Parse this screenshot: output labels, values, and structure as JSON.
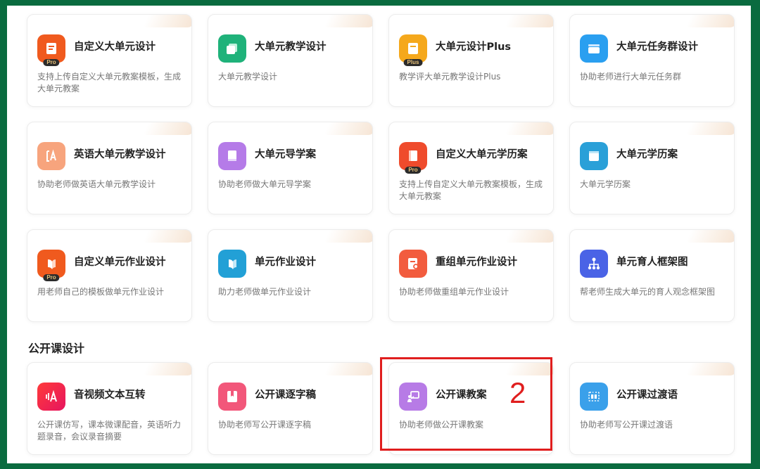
{
  "rows": [
    [
      {
        "title": "自定义大单元设计",
        "desc": "支持上传自定义大单元教案模板，生成大单元教案",
        "icon": "document-pro-icon",
        "color": "#f05a1e",
        "pro": "Pro"
      },
      {
        "title": "大单元教学设计",
        "desc": "大单元教学设计",
        "icon": "layers-icon",
        "color": "#1fb27a",
        "pro": ""
      },
      {
        "title": "大单元设计Plus",
        "desc": "教学评大单元教学设计Plus",
        "icon": "document-plus-icon",
        "color": "#f5a81c",
        "pro": "Plus"
      },
      {
        "title": "大单元任务群设计",
        "desc": "协助老师进行大单元任务群",
        "icon": "folder-icon",
        "color": "#2a9ff0",
        "pro": ""
      }
    ],
    [
      {
        "title": "英语大单元教学设计",
        "desc": "协助老师做英语大单元教学设计",
        "icon": "letter-a-icon",
        "color": "#f7a47d",
        "pro": ""
      },
      {
        "title": "大单元导学案",
        "desc": "协助老师做大单元导学案",
        "icon": "book-icon",
        "color": "#b57be8",
        "pro": ""
      },
      {
        "title": "自定义大单元学历案",
        "desc": "支持上传自定义大单元教案模板，生成大单元教案",
        "icon": "notebook-pro-icon",
        "color": "#ef4b2c",
        "pro": "Pro"
      },
      {
        "title": "大单元学历案",
        "desc": "大单元学历案",
        "icon": "window-icon",
        "color": "#2aa0d8",
        "pro": ""
      }
    ],
    [
      {
        "title": "自定义单元作业设计",
        "desc": "用老师自己的模板做单元作业设计",
        "icon": "pages-pro-icon",
        "color": "#f05a1e",
        "pro": "Pro"
      },
      {
        "title": "单元作业设计",
        "desc": "助力老师做单元作业设计",
        "icon": "pages-icon",
        "color": "#22a0d6",
        "pro": ""
      },
      {
        "title": "重组单元作业设计",
        "desc": "协助老师做重组单元作业设计",
        "icon": "doc-search-icon",
        "color": "#f25c3e",
        "pro": ""
      },
      {
        "title": "单元育人框架图",
        "desc": "帮老师生成大单元的育人观念框架图",
        "icon": "hierarchy-icon",
        "color": "#4a63e6",
        "pro": ""
      }
    ]
  ],
  "section": {
    "title": "公开课设计"
  },
  "public_cards": [
    {
      "title": "音视频文本互转",
      "desc": "公开课仿写，课本微课配音，英语听力题录音，会议录音摘要",
      "icon": "audio-text-icon",
      "color": "#ef2d3d",
      "pro": ""
    },
    {
      "title": "公开课逐字稿",
      "desc": "协助老师写公开课逐字稿",
      "icon": "bookmark-icon",
      "color": "#f2577a",
      "pro": ""
    },
    {
      "title": "公开课教案",
      "desc": "协助老师做公开课教案",
      "icon": "teacher-board-icon",
      "color": "#b77be6",
      "pro": ""
    },
    {
      "title": "公开课过渡语",
      "desc": "协助老师写公开课过渡语",
      "icon": "transition-icon",
      "color": "#3aa0ea",
      "pro": ""
    }
  ],
  "annotation": {
    "number": "2",
    "color": "#e01e1e"
  }
}
